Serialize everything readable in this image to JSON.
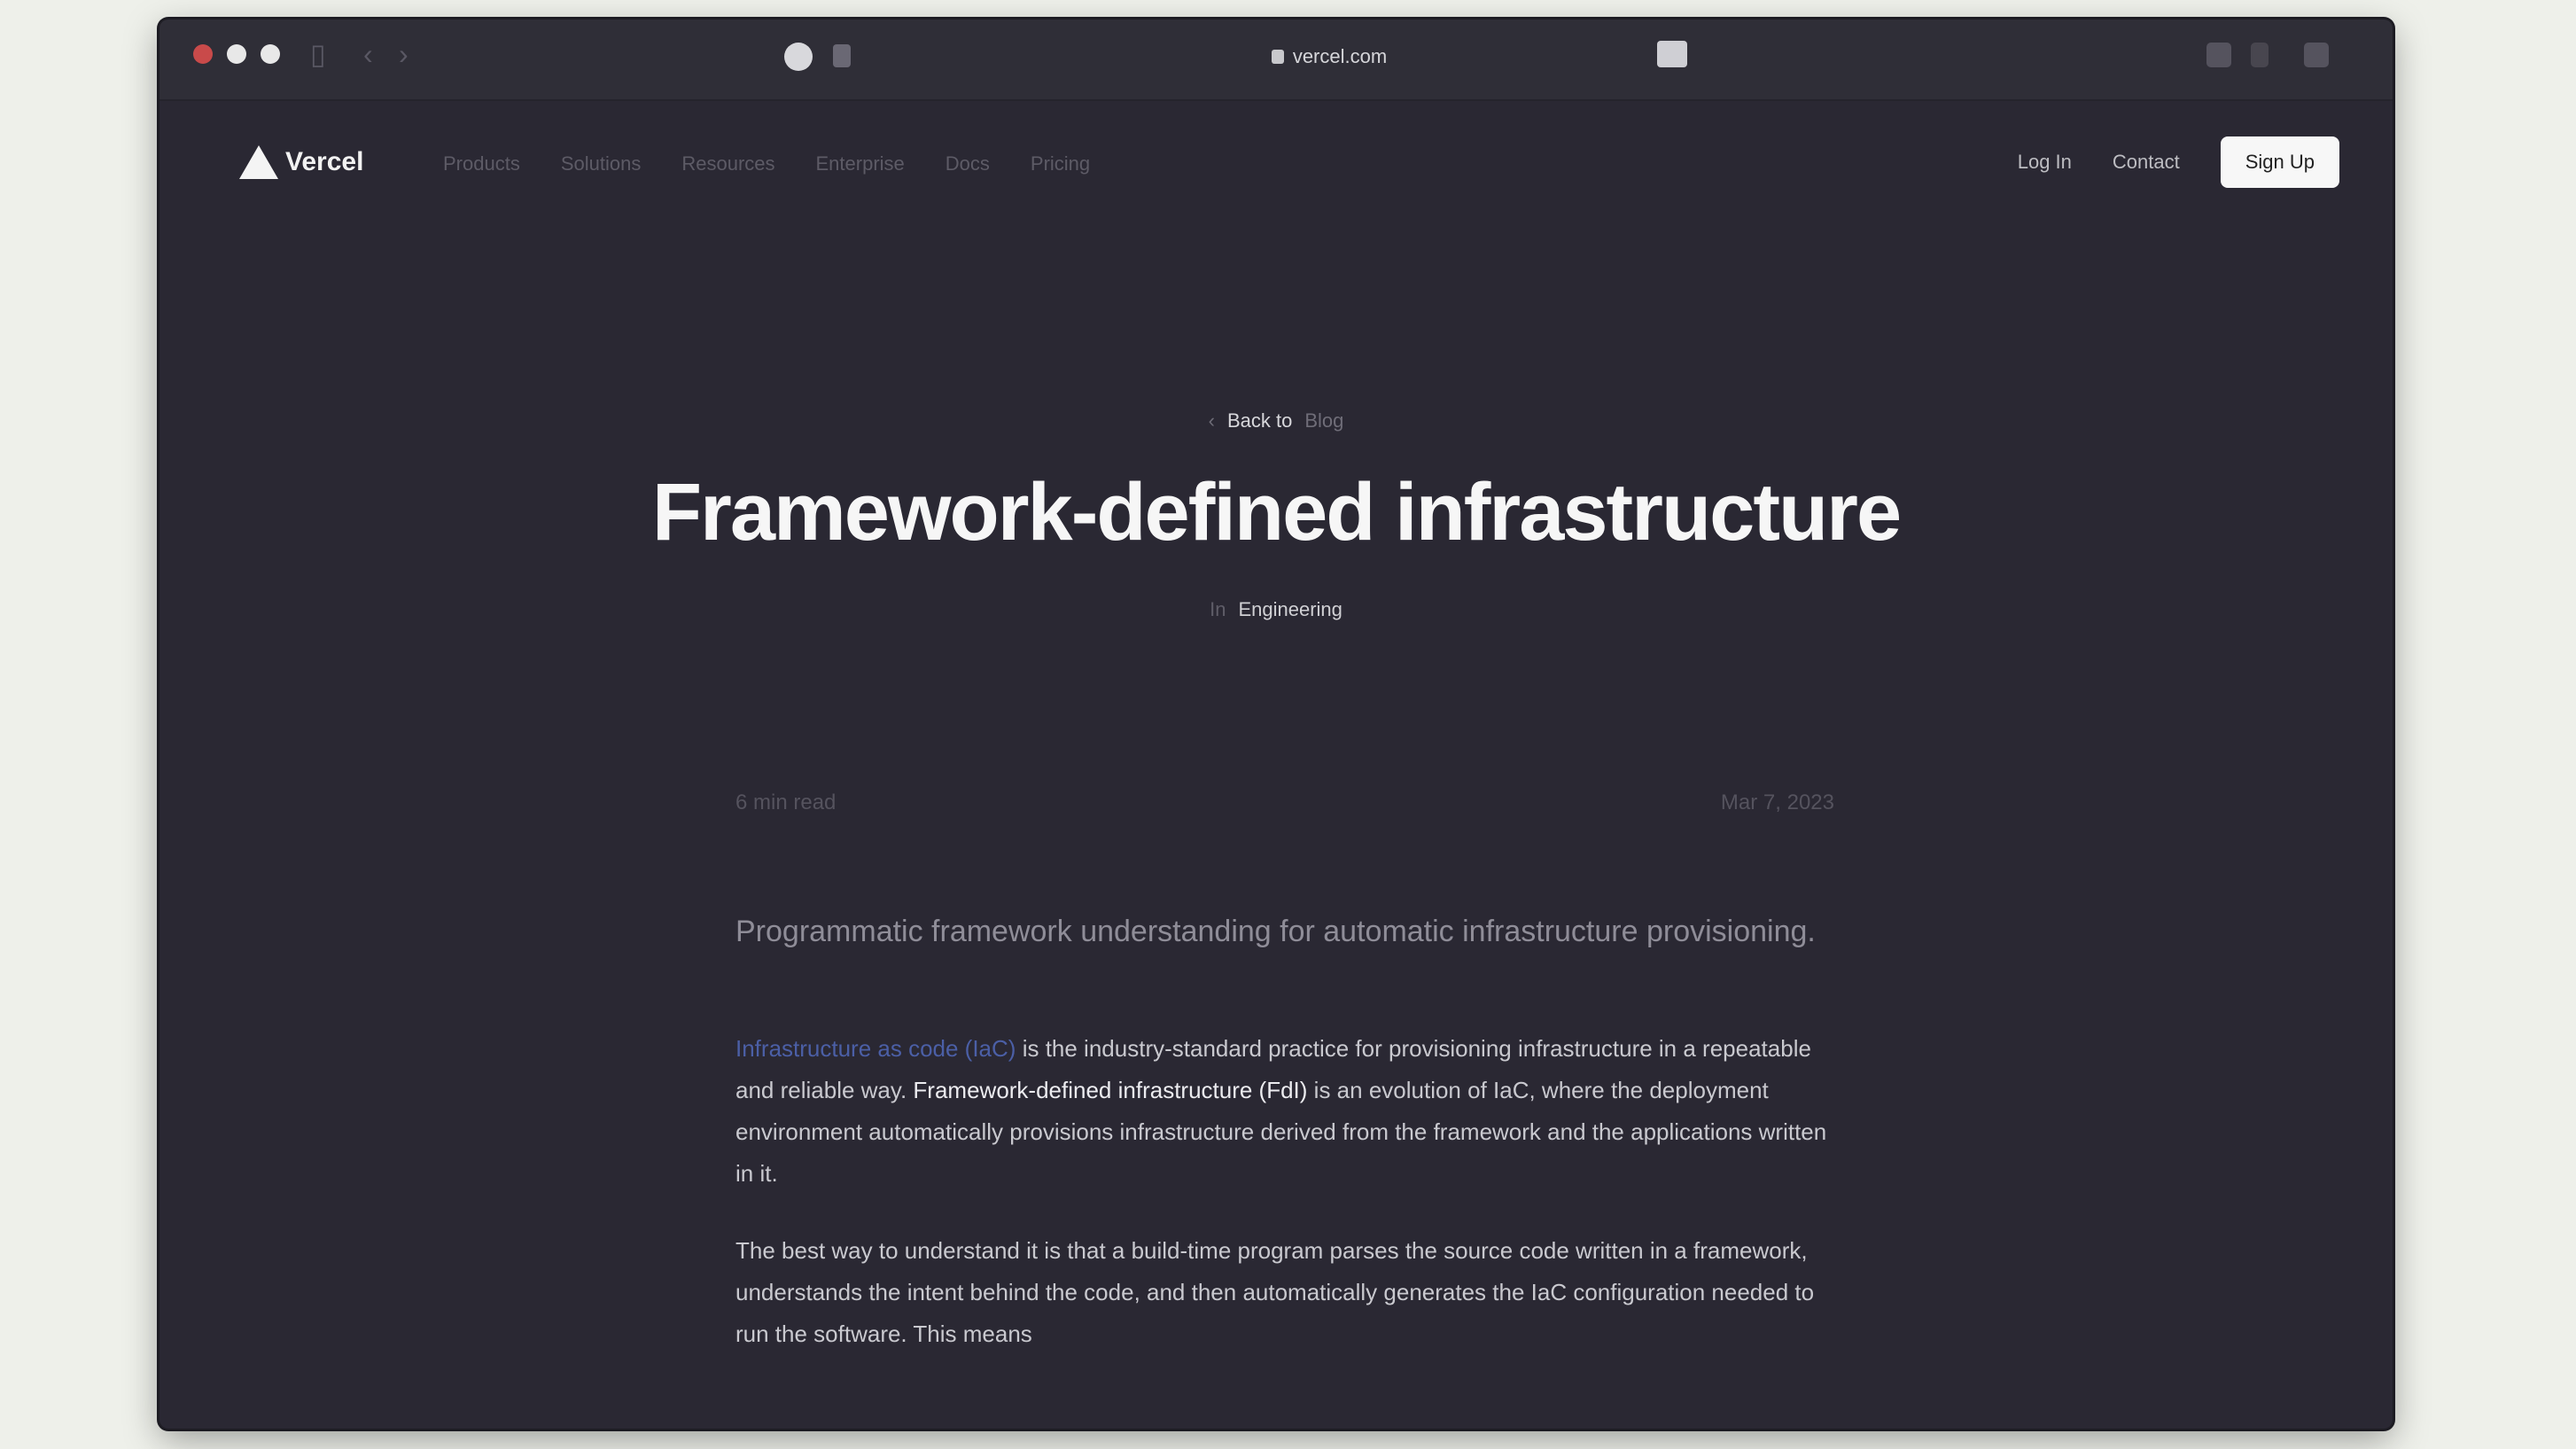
{
  "browser": {
    "url": "vercel.com",
    "back": "‹",
    "forward": "›"
  },
  "site": {
    "logo": "Vercel",
    "nav": [
      "Products",
      "Solutions",
      "Resources",
      "Enterprise",
      "Docs",
      "Pricing"
    ],
    "login": "Log In",
    "contact": "Contact",
    "signup": "Sign Up"
  },
  "hero": {
    "breadcrumb_back": "‹",
    "breadcrumb_current": "Back to",
    "breadcrumb_section": "Blog",
    "title": "Framework-defined infrastructure",
    "byline_prefix": "In",
    "byline_tag": "Engineering"
  },
  "article": {
    "meta_left": "6 min read",
    "meta_right": "Mar 7, 2023",
    "lead": "Programmatic framework understanding for automatic infrastructure provisioning.",
    "p1_link": "Infrastructure as code (IaC)",
    "p1_text": " is the industry-standard practice for provisioning infrastructure in a repeatable and reliable way. ",
    "p1_em": "Framework-defined infrastructure (FdI)",
    "p1_rest": " is an evolution of IaC, where the deployment environment automatically provisions infrastructure derived from the framework and the applications written in it.",
    "p2": "The best way to understand it is that a build-time program parses the source code written in a framework, understands the intent behind the code, and then automatically generates the IaC configuration needed to run the software. This means"
  }
}
